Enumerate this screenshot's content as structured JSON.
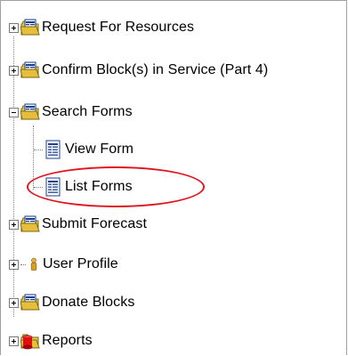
{
  "tree": {
    "items": [
      {
        "label": "Request For Resources",
        "icon": "folder-form-icon",
        "expander": "plus"
      },
      {
        "label": "Confirm Block(s) in Service (Part 4)",
        "icon": "folder-form-icon",
        "expander": "plus"
      },
      {
        "label": "Search Forms",
        "icon": "folder-form-icon",
        "expander": "minus"
      },
      {
        "label": "View Form",
        "icon": "document-icon",
        "expander": "none"
      },
      {
        "label": "List Forms",
        "icon": "document-icon",
        "expander": "none"
      },
      {
        "label": "Submit Forecast",
        "icon": "folder-form-icon",
        "expander": "plus"
      },
      {
        "label": "User Profile",
        "icon": "user-icon",
        "expander": "plus"
      },
      {
        "label": "Donate Blocks",
        "icon": "folder-form-icon",
        "expander": "plus"
      },
      {
        "label": "Reports",
        "icon": "reports-icon",
        "expander": "plus"
      }
    ]
  },
  "highlight": {
    "target": "List Forms",
    "color": "#e0141e"
  }
}
